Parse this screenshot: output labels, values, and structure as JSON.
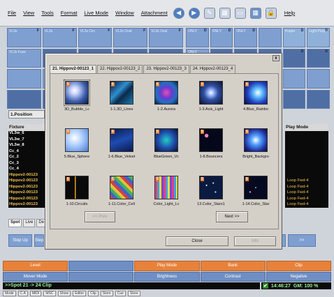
{
  "menubar": {
    "items": [
      "File",
      "View",
      "Tools",
      "Format",
      "Live Mode",
      "Window",
      "Attachment",
      "Help"
    ]
  },
  "top_left_grid": {
    "cells": [
      {
        "n": "F",
        "t": "VL3s"
      },
      {
        "n": "F",
        "t": "VL3s"
      },
      {
        "n": "F",
        "t": "VL3s Circ"
      },
      {
        "n": "F",
        "t": "VL3s Oval"
      },
      {
        "n": "F",
        "t": "VL3s Oval"
      },
      {
        "n": "",
        "t": "VL3s Fuze"
      },
      {
        "n": "",
        "t": ""
      },
      {
        "n": "",
        "t": ""
      },
      {
        "n": "",
        "t": ""
      },
      {
        "n": "",
        "t": ""
      }
    ]
  },
  "top_right_grid": {
    "cells": [
      {
        "n": "D",
        "t": "ONLY"
      },
      {
        "n": "D",
        "t": "ONLY"
      },
      {
        "n": "D",
        "t": "ONLY"
      },
      {
        "n": "",
        "t": ""
      },
      {
        "n": "D",
        "t": "Purple"
      },
      {
        "n": "D",
        "t": "Light Purple"
      },
      {
        "n": "",
        "t": "ONLY"
      },
      {
        "n": "",
        "t": ""
      },
      {
        "n": "",
        "t": ""
      },
      {
        "n": "",
        "t": ""
      },
      {
        "n": "D",
        "t": ""
      },
      {
        "n": "D",
        "t": ""
      }
    ]
  },
  "left_panel": {
    "tab_label": "1.Position",
    "header": "Fixture",
    "fixtures": [
      {
        "label": "VL3w_6",
        "color": "white"
      },
      {
        "label": "VL3w_7",
        "color": "white"
      },
      {
        "label": "VL3w_8",
        "color": "white"
      },
      {
        "label": "Cc_4",
        "color": "white"
      },
      {
        "label": "Cc_2",
        "color": "white"
      },
      {
        "label": "Cc_3",
        "color": "white"
      },
      {
        "label": "Cc_4",
        "color": "white"
      },
      {
        "label": "Hippov2-00123",
        "color": "yellow"
      },
      {
        "label": "Hippov2-00123",
        "color": "yellow"
      },
      {
        "label": "Hippov2-00123",
        "color": "yellow"
      },
      {
        "label": "Hippov2-00123",
        "color": "yellow"
      },
      {
        "label": "Hippov2-00123",
        "color": "yellow"
      },
      {
        "label": "Hippov2-00123",
        "color": "yellow"
      }
    ],
    "bottom_tabs": [
      "Spot",
      "Live",
      "De"
    ]
  },
  "right_panel": {
    "header": "Play Mode",
    "rows": [
      "",
      "",
      "",
      "",
      "",
      "",
      "",
      "",
      "Loop Fwd-4",
      "Loop Fwd-4",
      "Loop Fwd-4",
      "Loop Fwd-4",
      "Loop Fwd-4"
    ]
  },
  "step_bar": {
    "buttons": [
      "Step Up",
      "Step",
      "",
      "",
      "",
      "",
      "",
      "",
      ">>"
    ]
  },
  "orange_bar": {
    "row1": [
      "Level",
      "",
      "Play Mode",
      "Bank",
      "Clip"
    ],
    "row2": [
      "Mover Mode",
      "",
      "Brightness",
      "Contrast",
      "Negative"
    ]
  },
  "command_line": ">>Spot 21 -> 24 Clip",
  "clock": {
    "time": "14:46:27",
    "gm": "GM: 100 %"
  },
  "status_bar": [
    "Mode",
    "C.A",
    "MIDI",
    "MSC",
    "Show",
    "Editor",
    "Clip",
    "Store",
    "Cue",
    "Store"
  ],
  "dialog": {
    "tabs": [
      "21. Hippov2-00123_1",
      "22. Hippov2-00123_2",
      "23. Hippov2-00123_3",
      "24. Hippov2-00123_4"
    ],
    "close_x": "x",
    "thumbs": [
      {
        "num": "5",
        "label": "3D_Bubble_Lc",
        "style": "bubble"
      },
      {
        "num": "5",
        "label": "1-1.3D_Lines",
        "style": "lines"
      },
      {
        "num": "5",
        "label": "1-2.Aurora",
        "style": "aurora"
      },
      {
        "num": "5",
        "label": "1-3.Axis_Light",
        "style": "axis"
      },
      {
        "num": "5",
        "label": "4.Blue_Rainbo",
        "style": "rainbow"
      },
      {
        "num": "5",
        "label": "5.Blue_Sphere",
        "style": "sphere"
      },
      {
        "num": "5",
        "label": "1-6.Blue_Velvet",
        "style": "velvet"
      },
      {
        "num": "5",
        "label": "BlueGreen_Vc",
        "style": "bluegreen"
      },
      {
        "num": "5",
        "label": "1-8.Bouncers",
        "style": "bouncers"
      },
      {
        "num": "5",
        "label": "Bright_Backgro",
        "style": "bright"
      },
      {
        "num": "5",
        "label": "1-10.Circuits",
        "style": "circuits"
      },
      {
        "num": "5",
        "label": "1-11.Color_Cell",
        "style": "colorcell"
      },
      {
        "num": "5",
        "label": "Color_Light_Lc",
        "style": "colorlight"
      },
      {
        "num": "5",
        "label": "13.Color_Stars1",
        "style": "stars1"
      },
      {
        "num": "5",
        "label": "1-14.Color_Star",
        "style": "stars2"
      }
    ],
    "prev_label": "<< Prev",
    "next_label": "Next >>",
    "close_label": "Close",
    "info_label": "Info"
  },
  "colors": {
    "accent_orange": "#e8823a",
    "grid_blue": "#7f9fd0",
    "fixture_yellow": "#f0c24a",
    "cmd_green": "#9cf29c"
  }
}
